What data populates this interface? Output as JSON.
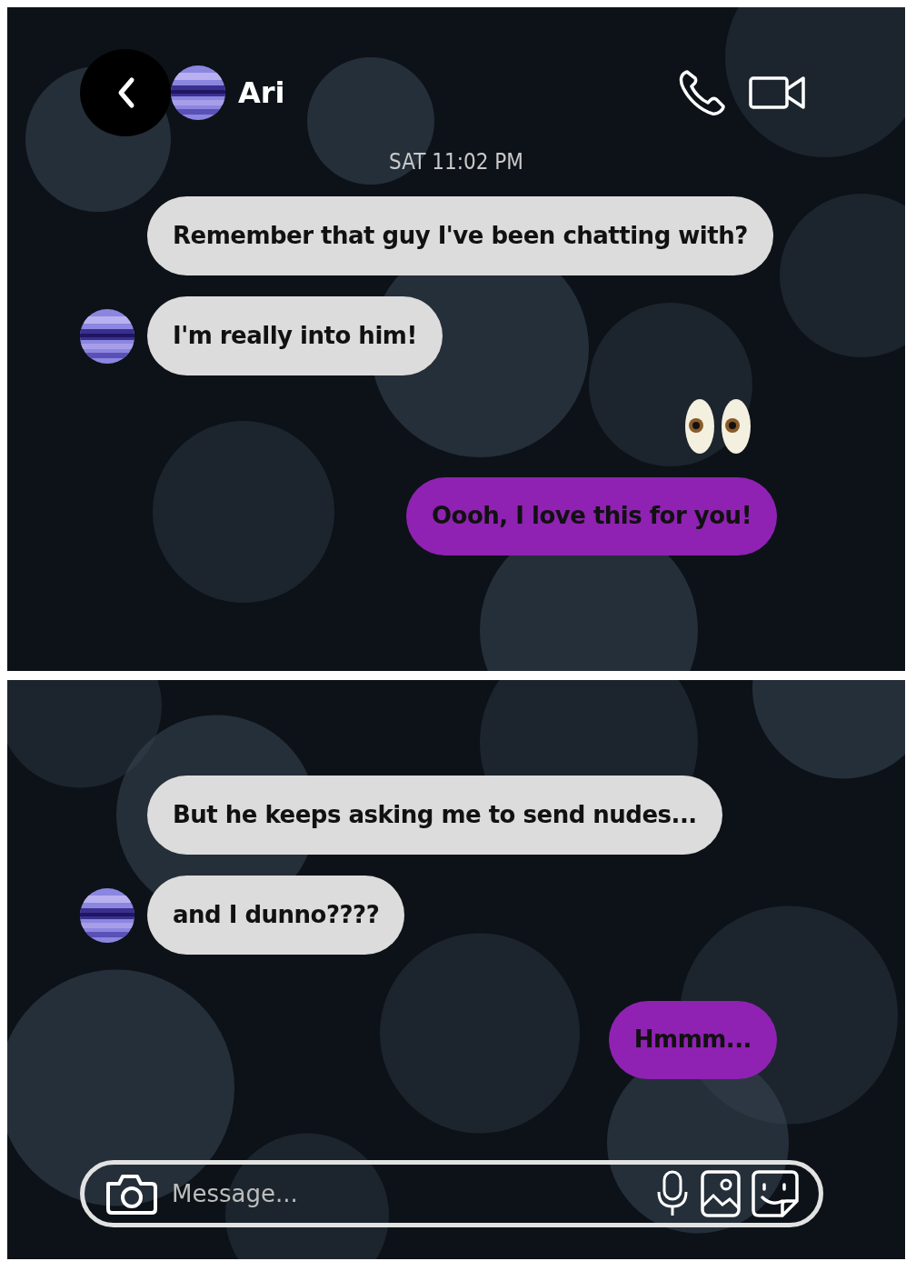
{
  "header": {
    "contact_name": "Ari"
  },
  "panels": [
    {
      "timestamp": "SAT 11:02 PM",
      "messages": [
        {
          "kind": "incoming",
          "avatar": false,
          "text": "Remember that guy I've been chatting with?"
        },
        {
          "kind": "incoming",
          "avatar": true,
          "text": "I'm really into him!"
        },
        {
          "kind": "sticker"
        },
        {
          "kind": "outgoing",
          "text": "Oooh, I love this for you!"
        }
      ]
    },
    {
      "messages": [
        {
          "kind": "incoming",
          "avatar": false,
          "text": "But he keeps asking me to send nudes..."
        },
        {
          "kind": "incoming",
          "avatar": true,
          "text": "and I dunno????"
        },
        {
          "kind": "outgoing",
          "text": "Hmmm..."
        }
      ]
    }
  ],
  "composer": {
    "placeholder": "Message..."
  }
}
